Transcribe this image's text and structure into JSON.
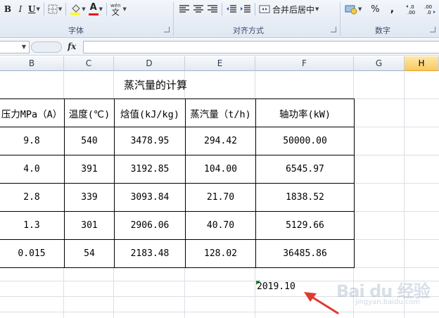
{
  "ribbon": {
    "font_group": {
      "label": "字体",
      "bold": "B",
      "italic": "I",
      "underline": "U",
      "font_color_glyph": "A",
      "wen_glyph": "wén",
      "wen_char": "文"
    },
    "align_group": {
      "label": "对齐方式",
      "merge_label": "合并后居中"
    },
    "number_group": {
      "label": "数字",
      "percent": "%",
      "comma": ",",
      "inc_decimal": "←.0\n.00",
      "dec_decimal": ".00\n→.0"
    }
  },
  "formula_bar": {
    "fx": "fx",
    "value": ""
  },
  "columns": [
    "B",
    "C",
    "D",
    "E",
    "F",
    "G",
    "H"
  ],
  "selected_column": "H",
  "sheet": {
    "title": "蒸汽量的计算",
    "headers": [
      "压力MPa（A）",
      "温度(℃)",
      "焓值(kJ/kg)",
      "蒸汽量（t/h)",
      "轴功率(kW)"
    ],
    "rows": [
      [
        "9.8",
        "540",
        "3478.95",
        "294.42",
        "50000.00"
      ],
      [
        "4.0",
        "391",
        "3192.85",
        "104.00",
        "6545.97"
      ],
      [
        "2.8",
        "339",
        "3093.84",
        "21.70",
        "1838.52"
      ],
      [
        "1.3",
        "301",
        "2906.06",
        "40.70",
        "5129.66"
      ],
      [
        "0.015",
        "54",
        "2183.48",
        "128.02",
        "36485.86"
      ]
    ],
    "date_cell": "2019.10"
  },
  "watermark": {
    "brand": "Bai du 经验",
    "url": "jingyan.baidu.com"
  },
  "colors": {
    "accent_selected_header": "#f9c860",
    "arrow": "#e03a2f",
    "error_triangle": "#1f8a2e"
  }
}
